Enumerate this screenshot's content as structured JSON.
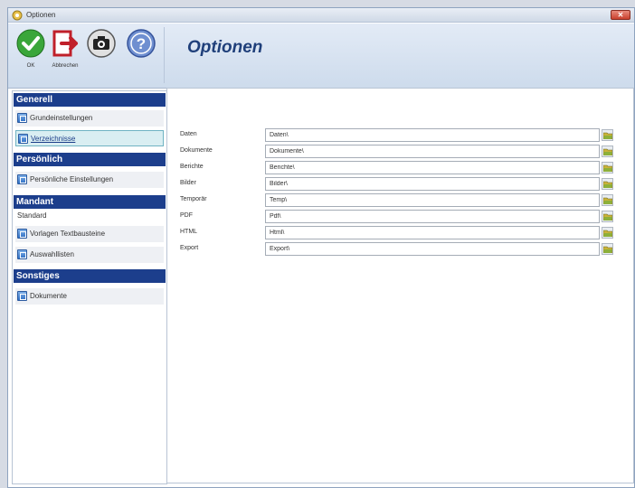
{
  "window": {
    "title": "Optionen"
  },
  "toolbar": {
    "ok_label": "OK",
    "cancel_label": "Abbrechen",
    "page_title": "Optionen"
  },
  "sidebar": {
    "sections": [
      {
        "title": "Generell",
        "items": [
          "Grundeinstellungen",
          "Verzeichnisse"
        ]
      },
      {
        "title": "Persönlich",
        "items": [
          "Persönliche Einstellungen"
        ]
      },
      {
        "title": "Mandant",
        "items": [
          "Standard",
          "Vorlagen Textbausteine",
          "Auswahllisten"
        ]
      },
      {
        "title": "Sonstiges",
        "items": [
          "Dokumente"
        ]
      }
    ],
    "selected": "Verzeichnisse"
  },
  "directories": {
    "rows": [
      {
        "label": "Daten",
        "value": "Daten\\"
      },
      {
        "label": "Dokumente",
        "value": "Dokumente\\"
      },
      {
        "label": "Berichte",
        "value": "Berichte\\"
      },
      {
        "label": "Bilder",
        "value": "Bilder\\"
      },
      {
        "label": "Temporär",
        "value": "Temp\\"
      },
      {
        "label": "PDF",
        "value": "Pdf\\"
      },
      {
        "label": "HTML",
        "value": "Html\\"
      },
      {
        "label": "Export",
        "value": "Export\\"
      }
    ]
  },
  "icons": {
    "ok": "checkmark-icon",
    "cancel": "exit-icon",
    "screenshot": "camera-icon",
    "help": "help-icon",
    "browse": "folder-icon"
  },
  "colors": {
    "section_header": "#1c3e8c",
    "title": "#1f3f7a",
    "selected_item": "#d9eef2"
  }
}
